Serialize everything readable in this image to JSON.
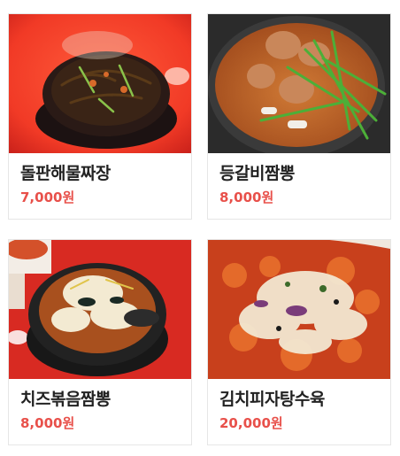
{
  "menu": {
    "items": [
      {
        "name": "돌판해물짜장",
        "price": "7,000원",
        "photo": "stone-plate-seafood-jjajang-photo"
      },
      {
        "name": "등갈비짬뽕",
        "price": "8,000원",
        "photo": "pork-rib-jjamppong-photo"
      },
      {
        "name": "치즈볶음짬뽕",
        "price": "8,000원",
        "photo": "cheese-stir-fried-jjamppong-photo"
      },
      {
        "name": "김치피자탕수육",
        "price": "20,000원",
        "photo": "kimchi-pizza-tangsuyuk-photo"
      }
    ]
  },
  "colors": {
    "price": "#e8504a",
    "name": "#222222",
    "border": "#e6e6e6"
  }
}
